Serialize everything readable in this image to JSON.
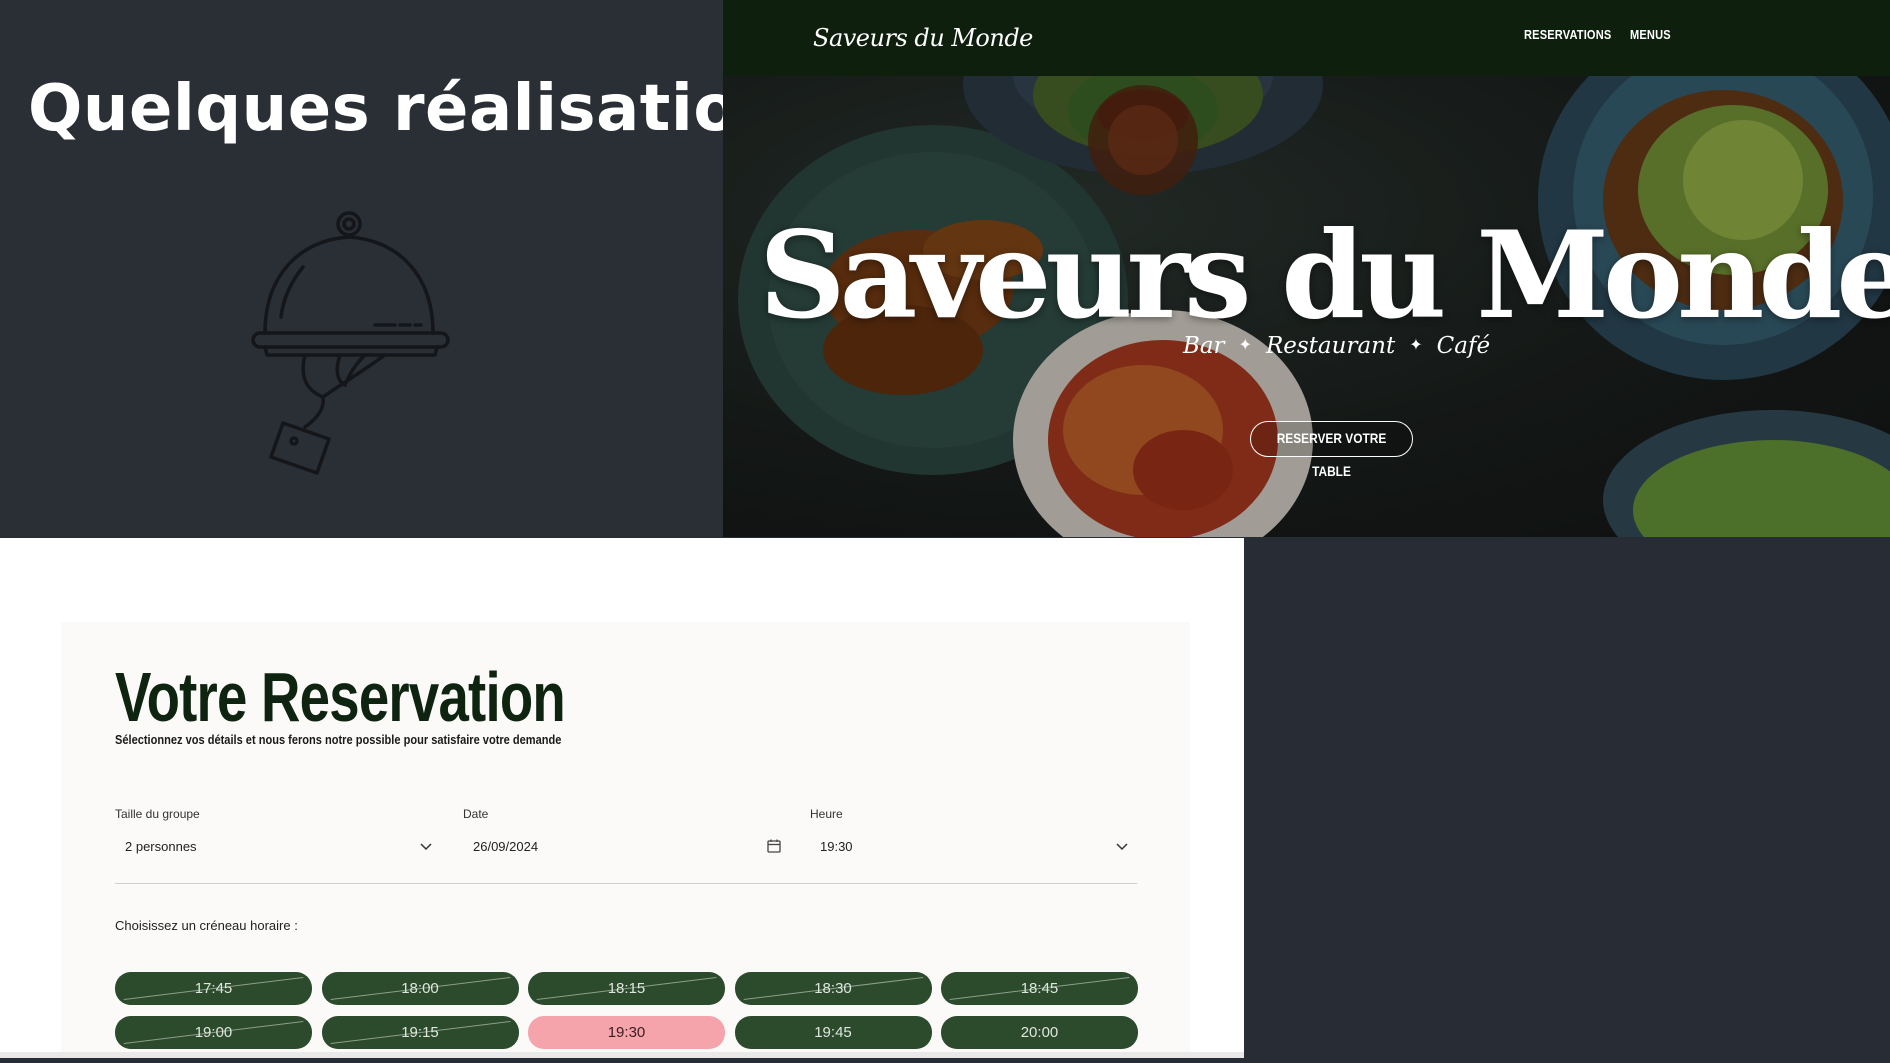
{
  "left_panel": {
    "heading": "Quelques réalisations",
    "illustration_icon": "cloche-serving-hand-icon"
  },
  "hero": {
    "nav": {
      "logo": "Saveurs du Monde",
      "links": [
        "RESERVATIONS",
        "MENUS"
      ]
    },
    "title": "Saveurs du Monde",
    "subtitle_parts": [
      "Bar",
      "Restaurant",
      "Café"
    ],
    "subtitle_separator": "✦",
    "cta_label": "RESERVER VOTRE TABLE",
    "nav_color": "#0f1f0d"
  },
  "reservation": {
    "title": "Votre Reservation",
    "subtitle": "Sélectionnez vos détails et nous ferons notre possible pour satisfaire votre demande",
    "fields": {
      "party": {
        "label": "Taille du groupe",
        "value": "2 personnes",
        "icon": "chevron-down-icon"
      },
      "date": {
        "label": "Date",
        "value": "26/09/2024",
        "icon": "calendar-icon"
      },
      "time": {
        "label": "Heure",
        "value": "19:30",
        "icon": "chevron-down-icon"
      }
    },
    "slots_label": "Choisissez un créneau horaire :",
    "slots": [
      {
        "time": "17:45",
        "state": "unavailable"
      },
      {
        "time": "18:00",
        "state": "unavailable"
      },
      {
        "time": "18:15",
        "state": "unavailable"
      },
      {
        "time": "18:30",
        "state": "unavailable"
      },
      {
        "time": "18:45",
        "state": "unavailable"
      },
      {
        "time": "19:00",
        "state": "unavailable"
      },
      {
        "time": "19:15",
        "state": "unavailable"
      },
      {
        "time": "19:30",
        "state": "selected"
      },
      {
        "time": "19:45",
        "state": "available"
      },
      {
        "time": "20:00",
        "state": "available"
      }
    ],
    "colors": {
      "slot": "#2c4a2c",
      "selected_slot": "#f4a4aa",
      "title": "#0e2410"
    }
  }
}
